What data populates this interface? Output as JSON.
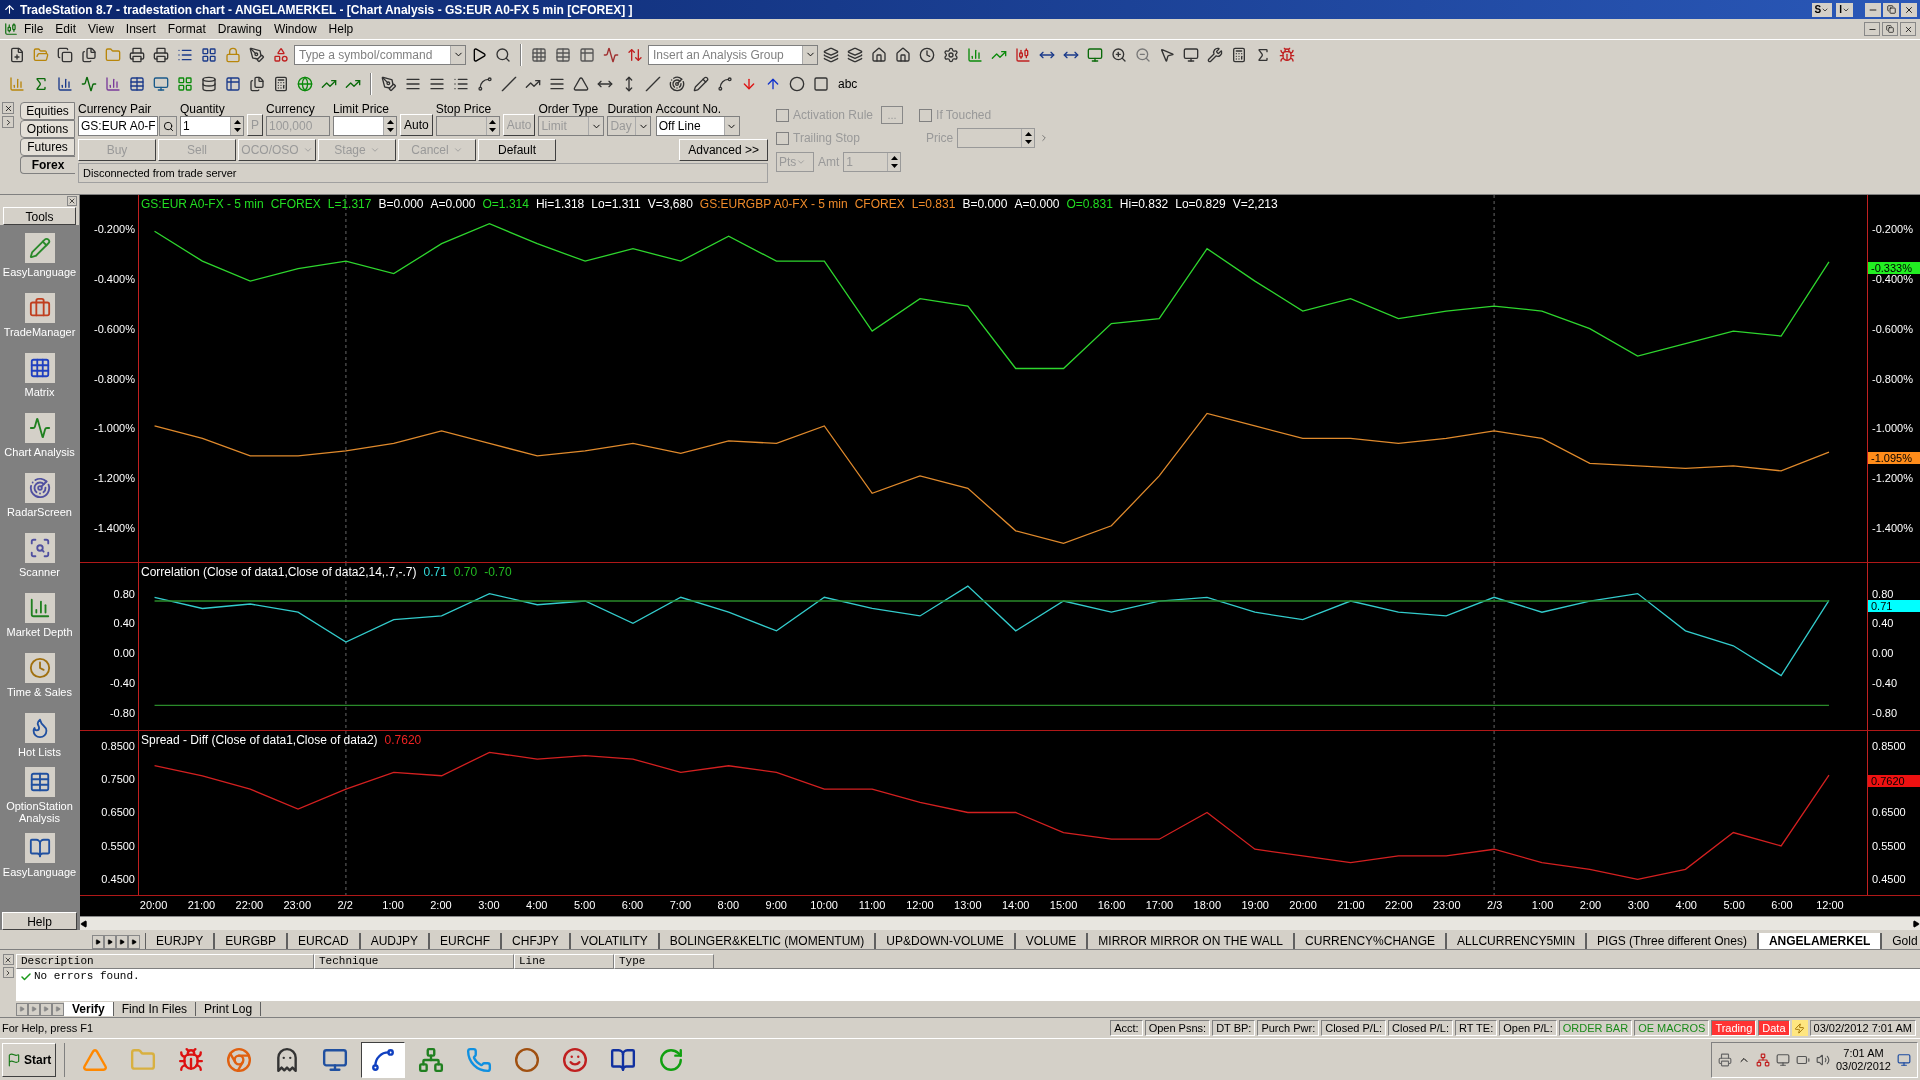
{
  "window": {
    "title": "TradeStation 8.7 - tradestation chart - ANGELAMERKEL - [Chart Analysis - GS:EUR A0-FX 5 min [CFOREX] ]",
    "extra_buttons": [
      "S",
      "I"
    ]
  },
  "menu": [
    "File",
    "Edit",
    "View",
    "Insert",
    "Format",
    "Drawing",
    "Window",
    "Help"
  ],
  "toolbar": {
    "symbol_combo": {
      "placeholder": "Type a symbol/command"
    },
    "analysis_combo": {
      "placeholder": "Insert an Analysis Group"
    },
    "text_tool": "abc"
  },
  "order_bar": {
    "asset_tabs": [
      {
        "label": "Equities",
        "selected": false
      },
      {
        "label": "Options",
        "selected": false
      },
      {
        "label": "Futures",
        "selected": false
      },
      {
        "label": "Forex",
        "selected": true
      }
    ],
    "fields": [
      {
        "kind": "text",
        "label": "Currency Pair",
        "value": "GS:EUR A0-F",
        "disabled": false,
        "search": true
      },
      {
        "kind": "spinner",
        "label": "Quantity",
        "value": "1",
        "disabled": false
      },
      {
        "kind": "button",
        "label": "P",
        "disabled": true
      },
      {
        "kind": "text",
        "label": "Currency",
        "value": "100,000",
        "disabled": true
      },
      {
        "kind": "spinner",
        "label": "Limit Price",
        "disabled": false
      },
      {
        "kind": "button",
        "label": "Auto",
        "disabled": false
      },
      {
        "kind": "spinner",
        "label": "Stop Price",
        "disabled": true
      },
      {
        "kind": "button",
        "label": "Auto",
        "disabled": true
      },
      {
        "kind": "select",
        "label": "Order Type",
        "value": "Limit",
        "disabled": true
      },
      {
        "kind": "select",
        "label": "Duration",
        "value": "Day",
        "disabled": true
      },
      {
        "kind": "select",
        "label": "Account No.",
        "value": "Off Line",
        "disabled": false
      }
    ],
    "buttons": [
      {
        "label": "Buy",
        "disabled": true,
        "dropdown": false
      },
      {
        "label": "Sell",
        "disabled": true,
        "dropdown": false
      },
      {
        "label": "OCO/OSO",
        "disabled": true,
        "dropdown": true
      },
      {
        "label": "Stage",
        "disabled": true,
        "dropdown": true
      },
      {
        "label": "Cancel",
        "disabled": true,
        "dropdown": true
      },
      {
        "label": "Default",
        "disabled": false,
        "dropdown": false
      }
    ],
    "advanced": "Advanced >>",
    "message": "Disconnected from trade server",
    "options": [
      {
        "label": "Activation Rule",
        "checked": false,
        "disabled": true
      },
      {
        "label": "Trailing Stop",
        "checked": false,
        "disabled": true
      }
    ],
    "ellipsis": "...",
    "if_touched": {
      "label": "If Touched",
      "checked": false,
      "disabled": true
    },
    "price": {
      "label": "Price"
    },
    "pts": "Pts",
    "amt": {
      "label": "Amt",
      "value": "1"
    }
  },
  "tools": {
    "title": "Tools",
    "items": [
      "EasyLanguage",
      "TradeManager",
      "Matrix",
      "Chart Analysis",
      "RadarScreen",
      "Scanner",
      "Market Depth",
      "Time & Sales",
      "Hot Lists",
      "OptionStation Analysis",
      "EasyLanguage"
    ],
    "help": "Help"
  },
  "panes": [
    {
      "legend": [
        {
          "text": "GS:EUR A0-FX - 5 min",
          "color": "#22dd22"
        },
        {
          "text": "CFOREX",
          "color": "#22dd22"
        },
        {
          "text": "L=1.317",
          "color": "#22dd22"
        },
        {
          "text": "B=0.000",
          "color": "#ffffff"
        },
        {
          "text": "A=0.000",
          "color": "#ffffff"
        },
        {
          "text": "O=1.314",
          "color": "#22dd22"
        },
        {
          "text": "Hi=1.318",
          "color": "#ffffff"
        },
        {
          "text": "Lo=1.311",
          "color": "#ffffff"
        },
        {
          "text": "V=3,680",
          "color": "#ffffff"
        },
        {
          "text": "GS:EURGBP A0-FX - 5 min",
          "color": "#ee8a2a"
        },
        {
          "text": "CFOREX",
          "color": "#ee8a2a"
        },
        {
          "text": "L=0.831",
          "color": "#ee8a2a"
        },
        {
          "text": "B=0.000",
          "color": "#ffffff"
        },
        {
          "text": "A=0.000",
          "color": "#ffffff"
        },
        {
          "text": "O=0.831",
          "color": "#22dd22"
        },
        {
          "text": "Hi=0.832",
          "color": "#ffffff"
        },
        {
          "text": "Lo=0.829",
          "color": "#ffffff"
        },
        {
          "text": "V=2,213",
          "color": "#ffffff"
        }
      ],
      "right_ticks": [
        "-0.200%",
        "-0.400%",
        "-0.600%",
        "-0.800%",
        "-1.000%",
        "-1.200%",
        "-1.400%"
      ],
      "markers": [
        {
          "label": "-0.333%",
          "color": "#22ee22"
        },
        {
          "label": "-1.095%",
          "color": "#ff8c1a"
        }
      ],
      "chart_data": {
        "type": "line",
        "ylim": [
          -1.535,
          -0.065
        ],
        "yticks": [
          {
            "value": -0.2,
            "label": "-0.200%"
          },
          {
            "value": -0.4,
            "label": "-0.400%"
          },
          {
            "value": -0.6,
            "label": "-0.600%"
          },
          {
            "value": -0.8,
            "label": "-0.800%"
          },
          {
            "value": -1.0,
            "label": "-1.000%"
          },
          {
            "value": -1.2,
            "label": "-1.200%"
          },
          {
            "value": -1.4,
            "label": "-1.400%"
          }
        ],
        "series": [
          {
            "color": "#2ed62e",
            "values": [
              -0.21,
              -0.33,
              -0.41,
              -0.36,
              -0.33,
              -0.38,
              -0.26,
              -0.18,
              -0.26,
              -0.33,
              -0.28,
              -0.33,
              -0.23,
              -0.33,
              -0.33,
              -0.61,
              -0.48,
              -0.51,
              -0.76,
              -0.76,
              -0.58,
              -0.56,
              -0.28,
              -0.41,
              -0.53,
              -0.48,
              -0.56,
              -0.53,
              -0.51,
              -0.53,
              -0.6,
              -0.71,
              -0.66,
              -0.61,
              -0.63,
              -0.333
            ]
          },
          {
            "color": "#e08a2c",
            "values": [
              -0.99,
              -1.04,
              -1.11,
              -1.11,
              -1.09,
              -1.06,
              -1.01,
              -1.06,
              -1.11,
              -1.09,
              -1.06,
              -1.1,
              -1.05,
              -1.06,
              -0.99,
              -1.26,
              -1.19,
              -1.24,
              -1.41,
              -1.46,
              -1.39,
              -1.19,
              -0.94,
              -0.99,
              -1.04,
              -1.04,
              -1.06,
              -1.04,
              -1.01,
              -1.04,
              -1.14,
              -1.15,
              -1.16,
              -1.15,
              -1.17,
              -1.095
            ]
          }
        ]
      }
    },
    {
      "legend": [
        {
          "text": "Correlation (Close of data1,Close of data2,14,.7,-.7)",
          "color": "#ffffff"
        },
        {
          "text": "0.71",
          "color": "#33dddd"
        },
        {
          "text": "0.70",
          "color": "#22bb22"
        },
        {
          "text": "-0.70",
          "color": "#22bb22"
        }
      ],
      "right_ticks": [
        "0.80",
        "0.40",
        "0.00",
        "-0.40",
        "-0.80"
      ],
      "markers": [
        {
          "label": "0.71",
          "color": "#00ffff"
        }
      ],
      "chart_data": {
        "type": "line",
        "ylim": [
          -1.03,
          1.21
        ],
        "yticks": [
          {
            "value": 0.8,
            "label": "0.80"
          },
          {
            "value": 0.4,
            "label": "0.40"
          },
          {
            "value": 0,
            "label": "0.00"
          },
          {
            "value": -0.4,
            "label": "-0.40"
          },
          {
            "value": -0.8,
            "label": "-0.80"
          }
        ],
        "series": [
          {
            "color": "#33cccc",
            "values": [
              0.75,
              0.6,
              0.66,
              0.55,
              0.15,
              0.45,
              0.5,
              0.8,
              0.65,
              0.7,
              0.4,
              0.75,
              0.55,
              0.3,
              0.75,
              0.6,
              0.5,
              0.9,
              0.3,
              0.7,
              0.55,
              0.7,
              0.75,
              0.55,
              0.45,
              0.7,
              0.55,
              0.5,
              0.75,
              0.55,
              0.7,
              0.8,
              0.3,
              0.1,
              -0.3,
              0.71
            ]
          },
          {
            "color": "#2a8a2a",
            "values": [
              0.7,
              0.7,
              0.7,
              0.7,
              0.7,
              0.7,
              0.7,
              0.7,
              0.7,
              0.7,
              0.7,
              0.7,
              0.7,
              0.7,
              0.7,
              0.7,
              0.7,
              0.7,
              0.7,
              0.7,
              0.7,
              0.7,
              0.7,
              0.7,
              0.7,
              0.7,
              0.7,
              0.7,
              0.7,
              0.7,
              0.7,
              0.7,
              0.7,
              0.7,
              0.7,
              0.7
            ]
          },
          {
            "color": "#2a8a2a",
            "values": [
              -0.7,
              -0.7,
              -0.7,
              -0.7,
              -0.7,
              -0.7,
              -0.7,
              -0.7,
              -0.7,
              -0.7,
              -0.7,
              -0.7,
              -0.7,
              -0.7,
              -0.7,
              -0.7,
              -0.7,
              -0.7,
              -0.7,
              -0.7,
              -0.7,
              -0.7,
              -0.7,
              -0.7,
              -0.7,
              -0.7,
              -0.7,
              -0.7,
              -0.7,
              -0.7,
              -0.7,
              -0.7,
              -0.7,
              -0.7,
              -0.7,
              -0.7
            ]
          }
        ]
      }
    },
    {
      "legend": [
        {
          "text": "Spread - Diff (Close of data1,Close of data2)",
          "color": "#ffffff"
        },
        {
          "text": "0.7620",
          "color": "#ee2222"
        }
      ],
      "right_ticks": [
        "0.8500",
        "0.6500",
        "0.5500",
        "0.4500"
      ],
      "markers": [
        {
          "label": "0.7620",
          "color": "#ee1111"
        }
      ],
      "chart_data": {
        "type": "line",
        "ylim": [
          0.403,
          0.894
        ],
        "yticks": [
          {
            "value": 0.85,
            "label": "0.8500"
          },
          {
            "value": 0.75,
            "label": "0.7500"
          },
          {
            "value": 0.65,
            "label": "0.6500"
          },
          {
            "value": 0.55,
            "label": "0.5500"
          },
          {
            "value": 0.45,
            "label": "0.4500"
          }
        ],
        "series": [
          {
            "color": "#d42020",
            "values": [
              0.79,
              0.76,
              0.72,
              0.66,
              0.72,
              0.77,
              0.76,
              0.83,
              0.81,
              0.82,
              0.81,
              0.77,
              0.79,
              0.77,
              0.72,
              0.72,
              0.68,
              0.65,
              0.65,
              0.59,
              0.57,
              0.57,
              0.65,
              0.54,
              0.52,
              0.5,
              0.52,
              0.52,
              0.54,
              0.5,
              0.48,
              0.45,
              0.48,
              0.59,
              0.55,
              0.762
            ]
          }
        ]
      }
    }
  ],
  "time_axis": [
    {
      "label": "20:00",
      "kind": "time"
    },
    {
      "label": "21:00",
      "kind": "time"
    },
    {
      "label": "22:00",
      "kind": "time"
    },
    {
      "label": "23:00",
      "kind": "time"
    },
    {
      "label": "2/2",
      "kind": "date"
    },
    {
      "label": "1:00",
      "kind": "time"
    },
    {
      "label": "2:00",
      "kind": "time"
    },
    {
      "label": "3:00",
      "kind": "time"
    },
    {
      "label": "4:00",
      "kind": "time"
    },
    {
      "label": "5:00",
      "kind": "time"
    },
    {
      "label": "6:00",
      "kind": "time"
    },
    {
      "label": "7:00",
      "kind": "time"
    },
    {
      "label": "8:00",
      "kind": "time"
    },
    {
      "label": "9:00",
      "kind": "time"
    },
    {
      "label": "10:00",
      "kind": "time"
    },
    {
      "label": "11:00",
      "kind": "time"
    },
    {
      "label": "12:00",
      "kind": "time"
    },
    {
      "label": "13:00",
      "kind": "time"
    },
    {
      "label": "14:00",
      "kind": "time"
    },
    {
      "label": "15:00",
      "kind": "time"
    },
    {
      "label": "16:00",
      "kind": "time"
    },
    {
      "label": "17:00",
      "kind": "time"
    },
    {
      "label": "18:00",
      "kind": "time"
    },
    {
      "label": "19:00",
      "kind": "time"
    },
    {
      "label": "20:00",
      "kind": "time"
    },
    {
      "label": "21:00",
      "kind": "time"
    },
    {
      "label": "22:00",
      "kind": "time"
    },
    {
      "label": "23:00",
      "kind": "time"
    },
    {
      "label": "2/3",
      "kind": "date"
    },
    {
      "label": "1:00",
      "kind": "time"
    },
    {
      "label": "2:00",
      "kind": "time"
    },
    {
      "label": "3:00",
      "kind": "time"
    },
    {
      "label": "4:00",
      "kind": "time"
    },
    {
      "label": "5:00",
      "kind": "time"
    },
    {
      "label": "6:00",
      "kind": "time"
    },
    {
      "label": "12:00",
      "kind": "time"
    }
  ],
  "workspace_tabs": [
    {
      "label": "EURJPY",
      "selected": false
    },
    {
      "label": "EURGBP",
      "selected": false
    },
    {
      "label": "EURCAD",
      "selected": false
    },
    {
      "label": "AUDJPY",
      "selected": false
    },
    {
      "label": "EURCHF",
      "selected": false
    },
    {
      "label": "CHFJPY",
      "selected": false
    },
    {
      "label": "VOLATILITY",
      "selected": false
    },
    {
      "label": "BOLINGER&KELTIC (MOMENTUM)",
      "selected": false
    },
    {
      "label": "UP&DOWN-VOLUME",
      "selected": false
    },
    {
      "label": "VOLUME",
      "selected": false
    },
    {
      "label": "MIRROR MIRROR ON THE WALL",
      "selected": false
    },
    {
      "label": "CURRENCY%CHANGE",
      "selected": false
    },
    {
      "label": "ALLCURRENCY5MIN",
      "selected": false
    },
    {
      "label": "PIGS (Three different Ones)",
      "selected": false
    },
    {
      "label": "ANGELAMERKEL",
      "selected": true
    },
    {
      "label": "Gold",
      "selected": false
    }
  ],
  "output": {
    "columns": [
      "Description",
      "Technique",
      "Line",
      "Type"
    ],
    "rows": [
      {
        "description": "No errors found.",
        "ok": true
      }
    ],
    "tabs": [
      {
        "label": "Verify",
        "selected": true
      },
      {
        "label": "Find In Files",
        "selected": false
      },
      {
        "label": "Print Log",
        "selected": false
      }
    ]
  },
  "status_bar": {
    "help": "For Help, press F1",
    "cells": [
      {
        "text": "Acct:",
        "kind": "plain"
      },
      {
        "text": "Open Psns:",
        "kind": "plain"
      },
      {
        "text": "DT BP:",
        "kind": "plain"
      },
      {
        "text": "Purch Pwr:",
        "kind": "plain"
      },
      {
        "text": "Closed P/L:",
        "kind": "plain"
      },
      {
        "text": "Closed P/L:",
        "kind": "plain"
      },
      {
        "text": "RT TE:",
        "kind": "plain"
      },
      {
        "text": "Open P/L:",
        "kind": "plain"
      },
      {
        "text": "ORDER BAR",
        "kind": "ok"
      },
      {
        "text": "OE MACROS",
        "kind": "ok"
      },
      {
        "text": "Trading",
        "kind": "alert"
      },
      {
        "text": "Data",
        "kind": "alert"
      }
    ],
    "datetime": "03/02/2012 7:01 AM"
  },
  "taskbar": {
    "start": "Start",
    "time": "7:01 AM",
    "date": "03/02/2012"
  }
}
